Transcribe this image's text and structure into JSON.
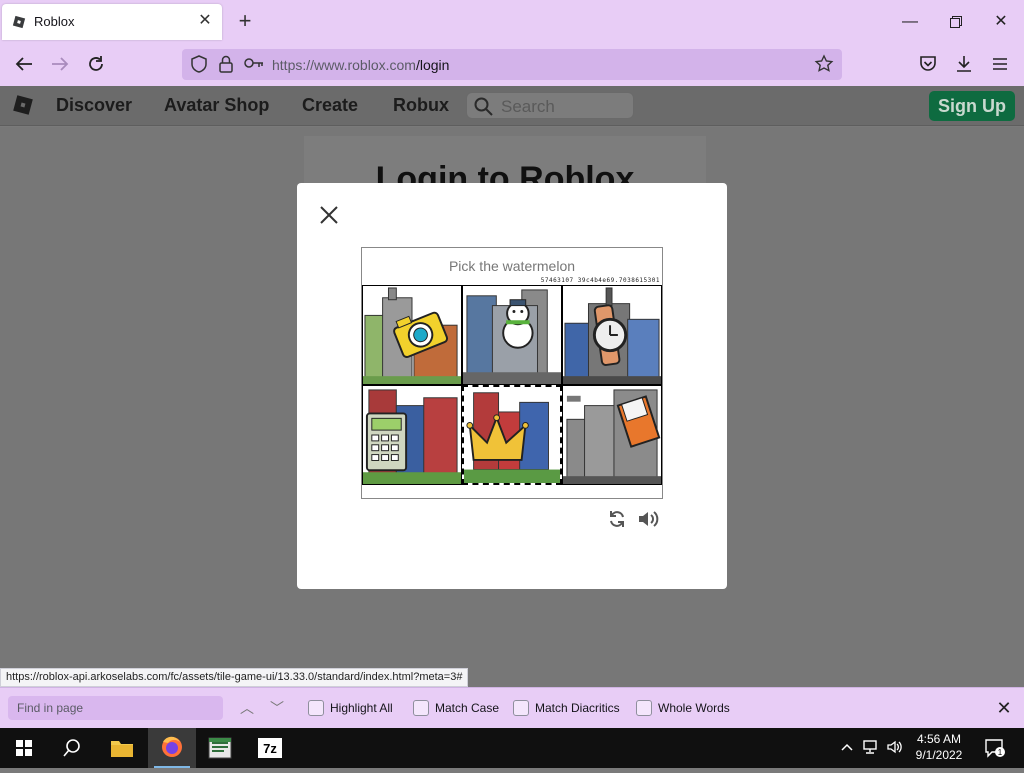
{
  "browser": {
    "tab_title": "Roblox",
    "url_host": "https://www.roblox.com",
    "url_path": "/login",
    "status_url": "https://roblox-api.arkoselabs.com/fc/assets/tile-game-ui/13.33.0/standard/index.html?meta=3#"
  },
  "roblox_header": {
    "nav": [
      "Discover",
      "Avatar Shop",
      "Create",
      "Robux"
    ],
    "search_placeholder": "Search",
    "signup_label": "Sign Up"
  },
  "login": {
    "title": "Login to Roblox"
  },
  "captcha": {
    "prompt": "Pick the watermelon",
    "code": "57463107 39c4b4e69.7038615301",
    "tiles": [
      {
        "object": "camera",
        "selected": false
      },
      {
        "object": "snowman",
        "selected": false
      },
      {
        "object": "wristwatch",
        "selected": false
      },
      {
        "object": "calculator",
        "selected": false
      },
      {
        "object": "crown",
        "selected": true
      },
      {
        "object": "paper-bag",
        "selected": false
      }
    ]
  },
  "findbar": {
    "placeholder": "Find in page",
    "options": [
      "Highlight All",
      "Match Case",
      "Match Diacritics",
      "Whole Words"
    ]
  },
  "taskbar": {
    "time": "4:56 AM",
    "date": "9/1/2022"
  },
  "colors": {
    "chrome": "#e8cdf6",
    "urlbar": "#d3b3ea",
    "signup": "#0e6b40"
  }
}
